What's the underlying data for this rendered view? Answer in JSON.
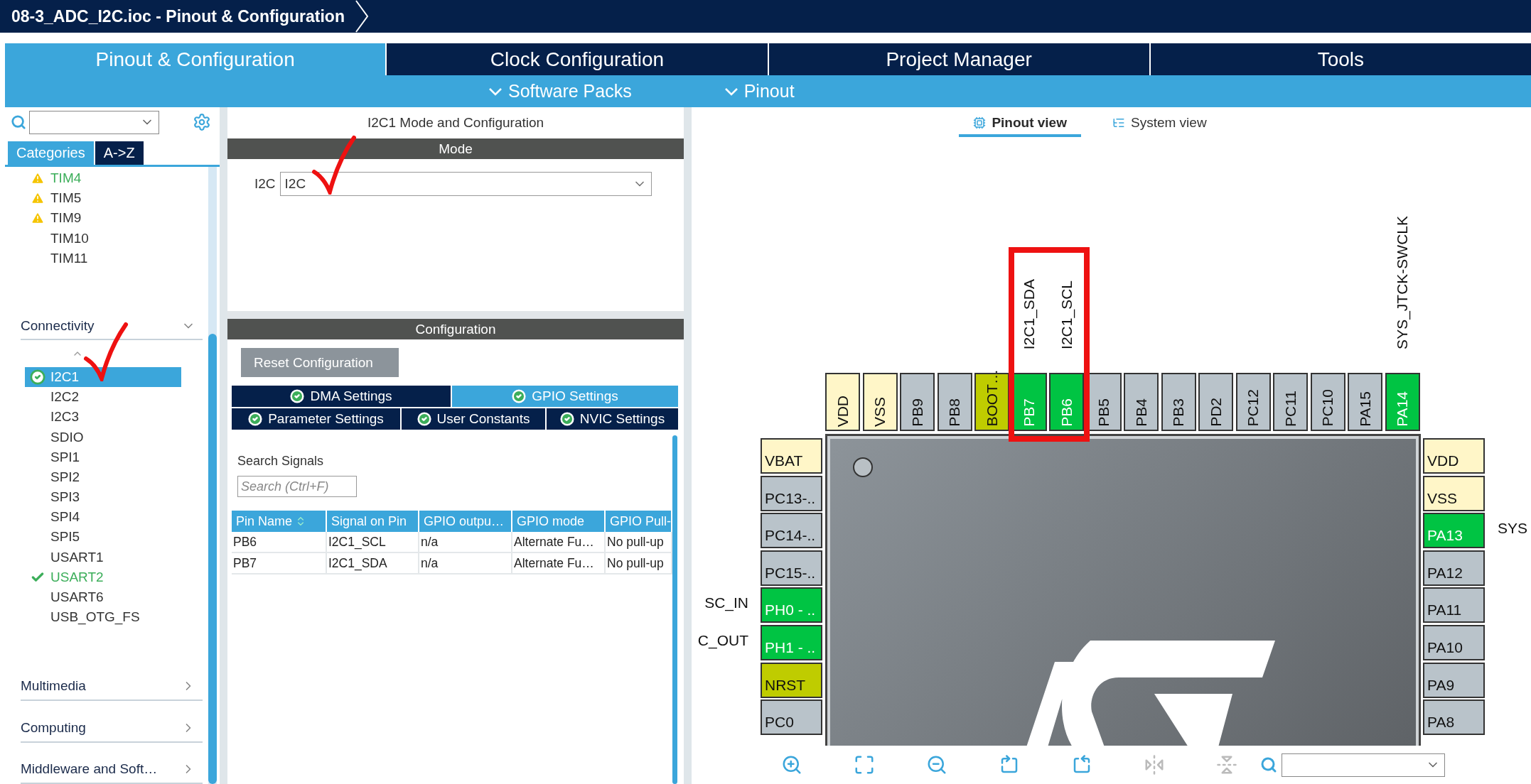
{
  "title": "08-3_ADC_I2C.ioc - Pinout & Configuration",
  "main_tabs": [
    {
      "label": "Pinout & Configuration",
      "selected": true
    },
    {
      "label": "Clock Configuration",
      "selected": false
    },
    {
      "label": "Project Manager",
      "selected": false
    },
    {
      "label": "Tools",
      "selected": false
    }
  ],
  "sub_menus": [
    "Software Packs",
    "Pinout"
  ],
  "sidebar": {
    "category_tabs": [
      {
        "label": "Categories",
        "selected": true
      },
      {
        "label": "A->Z",
        "selected": false
      }
    ],
    "items": [
      {
        "label": "TIM4",
        "kind": "warning",
        "configured": true,
        "selected": false
      },
      {
        "label": "TIM5",
        "kind": "warning",
        "configured": false,
        "selected": false
      },
      {
        "label": "TIM9",
        "kind": "warning",
        "configured": false,
        "selected": false
      },
      {
        "label": "TIM10",
        "kind": "plain",
        "configured": false,
        "selected": false
      },
      {
        "label": "TIM11",
        "kind": "plain",
        "configured": false,
        "selected": false
      }
    ],
    "sections": [
      {
        "label": "Connectivity",
        "expanded": true,
        "items": [
          {
            "label": "I2C1",
            "kind": "done",
            "configured": true,
            "selected": true
          },
          {
            "label": "I2C2",
            "kind": "plain",
            "configured": false,
            "selected": false
          },
          {
            "label": "I2C3",
            "kind": "plain",
            "configured": false,
            "selected": false
          },
          {
            "label": "SDIO",
            "kind": "plain",
            "configured": false,
            "selected": false
          },
          {
            "label": "SPI1",
            "kind": "plain",
            "configured": false,
            "selected": false
          },
          {
            "label": "SPI2",
            "kind": "plain",
            "configured": false,
            "selected": false
          },
          {
            "label": "SPI3",
            "kind": "plain",
            "configured": false,
            "selected": false
          },
          {
            "label": "SPI4",
            "kind": "plain",
            "configured": false,
            "selected": false
          },
          {
            "label": "SPI5",
            "kind": "plain",
            "configured": false,
            "selected": false
          },
          {
            "label": "USART1",
            "kind": "plain",
            "configured": false,
            "selected": false
          },
          {
            "label": "USART2",
            "kind": "done",
            "configured": true,
            "selected": false
          },
          {
            "label": "USART6",
            "kind": "plain",
            "configured": false,
            "selected": false
          },
          {
            "label": "USB_OTG_FS",
            "kind": "plain",
            "configured": false,
            "selected": false
          }
        ]
      },
      {
        "label": "Multimedia",
        "expanded": false
      },
      {
        "label": "Computing",
        "expanded": false
      },
      {
        "label": "Middleware and Soft…",
        "expanded": false
      }
    ]
  },
  "config": {
    "title": "I2C1 Mode and Configuration",
    "mode_header": "Mode",
    "mode_label": "I2C",
    "mode_value": "I2C",
    "config_header": "Configuration",
    "reset_button": "Reset Configuration",
    "tab_rows": [
      [
        {
          "label": "DMA Settings",
          "selected": false
        },
        {
          "label": "GPIO Settings",
          "selected": true
        }
      ],
      [
        {
          "label": "Parameter Settings",
          "selected": false
        },
        {
          "label": "User Constants",
          "selected": false
        },
        {
          "label": "NVIC Settings",
          "selected": false
        }
      ]
    ],
    "search_label": "Search Signals",
    "search_placeholder": "Search (Ctrl+F)",
    "table": {
      "columns": [
        "Pin Name",
        "Signal on Pin",
        "GPIO outpu…",
        "GPIO mode",
        "GPIO Pull-"
      ],
      "rows": [
        [
          "PB6",
          "I2C1_SCL",
          "n/a",
          "Alternate Fu…",
          "No pull-up"
        ],
        [
          "PB7",
          "I2C1_SDA",
          "n/a",
          "Alternate Fu…",
          "No pull-up"
        ]
      ]
    }
  },
  "view_tabs": [
    {
      "label": "Pinout view",
      "selected": true
    },
    {
      "label": "System view",
      "selected": false
    }
  ],
  "chip": {
    "top_pins": [
      {
        "label": "VDD",
        "kind": "power"
      },
      {
        "label": "VSS",
        "kind": "power"
      },
      {
        "label": "PB9",
        "kind": "io"
      },
      {
        "label": "PB8",
        "kind": "io"
      },
      {
        "label": "BOOT…",
        "kind": "reset"
      },
      {
        "label": "PB7",
        "kind": "assigned",
        "signal": "I2C1_SDA"
      },
      {
        "label": "PB6",
        "kind": "assigned",
        "signal": "I2C1_SCL"
      },
      {
        "label": "PB5",
        "kind": "io"
      },
      {
        "label": "PB4",
        "kind": "io"
      },
      {
        "label": "PB3",
        "kind": "io"
      },
      {
        "label": "PD2",
        "kind": "io"
      },
      {
        "label": "PC12",
        "kind": "io"
      },
      {
        "label": "PC11",
        "kind": "io"
      },
      {
        "label": "PC10",
        "kind": "io"
      },
      {
        "label": "PA15",
        "kind": "io"
      },
      {
        "label": "PA14",
        "kind": "assigned",
        "signal": "SYS_JTCK-SWCLK"
      }
    ],
    "left_pins": [
      {
        "label": "VBAT",
        "kind": "power"
      },
      {
        "label": "PC13-..",
        "kind": "io"
      },
      {
        "label": "PC14-..",
        "kind": "io"
      },
      {
        "label": "PC15-..",
        "kind": "io"
      },
      {
        "label": "PH0 - ..",
        "kind": "assigned",
        "signal": "SC_IN"
      },
      {
        "label": "PH1 - ..",
        "kind": "assigned",
        "signal": "C_OUT"
      },
      {
        "label": "NRST",
        "kind": "reset"
      },
      {
        "label": "PC0",
        "kind": "io"
      }
    ],
    "right_pins": [
      {
        "label": "VDD",
        "kind": "power"
      },
      {
        "label": "VSS",
        "kind": "power"
      },
      {
        "label": "PA13",
        "kind": "assigned",
        "signal": "SYS"
      },
      {
        "label": "PA12",
        "kind": "io"
      },
      {
        "label": "PA11",
        "kind": "io"
      },
      {
        "label": "PA10",
        "kind": "io"
      },
      {
        "label": "PA9",
        "kind": "io"
      },
      {
        "label": "PA8",
        "kind": "io"
      }
    ]
  }
}
